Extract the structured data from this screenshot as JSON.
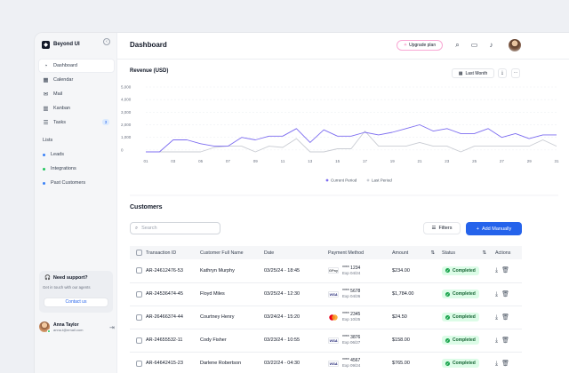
{
  "brand": {
    "name": "Beyond UI"
  },
  "sidebar": {
    "items": [
      {
        "label": "Dashboard",
        "icon": "dashboard-icon",
        "active": true
      },
      {
        "label": "Calendar",
        "icon": "calendar-icon"
      },
      {
        "label": "Mail",
        "icon": "mail-icon"
      },
      {
        "label": "Kanban",
        "icon": "kanban-icon"
      },
      {
        "label": "Tasks",
        "icon": "tasks-icon",
        "badge": "3"
      }
    ],
    "lists_heading": "Lists",
    "lists": [
      {
        "label": "Leads",
        "color": "#3b82f6"
      },
      {
        "label": "Integrations",
        "color": "#22c55e"
      },
      {
        "label": "Past Customers",
        "color": "#3b82f6"
      }
    ],
    "support": {
      "title": "Need support?",
      "subtitle": "Get in touch with our agents",
      "button": "Contact us"
    },
    "user": {
      "name": "Anna Taylor",
      "email": "anna.t@email.com"
    }
  },
  "header": {
    "title": "Dashboard",
    "upgrade": "Upgrade plan"
  },
  "revenue": {
    "title": "Revenue (USD)",
    "period": "Last Month",
    "more": "···",
    "download": "⤓"
  },
  "chart_data": {
    "type": "line",
    "title": "Revenue (USD)",
    "x": [
      "01",
      "02",
      "03",
      "04",
      "05",
      "06",
      "07",
      "08",
      "09",
      "10",
      "11",
      "12",
      "13",
      "14",
      "15",
      "16",
      "17",
      "18",
      "19",
      "20",
      "21",
      "22",
      "23",
      "24",
      "25",
      "26",
      "27",
      "28",
      "29",
      "30",
      "31"
    ],
    "x_tick_labels": [
      "01",
      "03",
      "05",
      "07",
      "09",
      "11",
      "13",
      "15",
      "17",
      "19",
      "21",
      "23",
      "25",
      "27",
      "29",
      "31"
    ],
    "y_tick_labels": [
      "5,000",
      "4,000",
      "3,000",
      "2,000",
      "1,000",
      "0"
    ],
    "ylim": [
      -150,
      5000
    ],
    "series": [
      {
        "name": "Current Period",
        "color": "#7c6cf0",
        "values": [
          -150,
          -150,
          800,
          800,
          500,
          300,
          300,
          1000,
          800,
          1100,
          1100,
          1700,
          600,
          1600,
          1100,
          1100,
          1400,
          1200,
          1400,
          1700,
          2000,
          1500,
          1700,
          1300,
          1300,
          1700,
          1000,
          1300,
          900,
          1200,
          1200
        ]
      },
      {
        "name": "Last Period",
        "color": "#c9ccd3",
        "values": [
          -150,
          -150,
          -150,
          -150,
          -150,
          200,
          300,
          300,
          -150,
          300,
          200,
          900,
          -150,
          -150,
          100,
          100,
          1500,
          300,
          300,
          300,
          600,
          300,
          300,
          -150,
          300,
          300,
          300,
          300,
          300,
          800,
          300
        ]
      }
    ],
    "legend": "bottom",
    "grid": true
  },
  "customers": {
    "title": "Customers",
    "search_placeholder": "Search",
    "filters": "Filters",
    "add": "Add Manually",
    "columns": [
      "Transaction ID",
      "Customer Full Name",
      "Date",
      "Payment Method",
      "Amount",
      "Status",
      "Actions"
    ],
    "rows": [
      {
        "id": "AR-24612476-53",
        "name": "Kathryn Murphy",
        "date": "03/25/24 - 18:45",
        "card": "GPay",
        "number": "**** 1234",
        "exp": "Exp 04/24",
        "amount": "$234.00",
        "status": "Completed"
      },
      {
        "id": "AR-24536474-45",
        "name": "Floyd Miles",
        "date": "03/25/24 - 12:30",
        "card": "VISA",
        "number": "**** 5678",
        "exp": "Exp 04/26",
        "amount": "$1,784.00",
        "status": "Completed"
      },
      {
        "id": "AR-26466374-44",
        "name": "Courtney Henry",
        "date": "03/24/24 - 15:20",
        "card": "MC",
        "number": "**** 2345",
        "exp": "Exp 10/25",
        "amount": "$24.50",
        "status": "Completed"
      },
      {
        "id": "AR-24655532-11",
        "name": "Cody Fisher",
        "date": "03/23/24 - 10:55",
        "card": "VISA",
        "number": "**** 3876",
        "exp": "Exp 06/27",
        "amount": "$158.00",
        "status": "Completed"
      },
      {
        "id": "AR-64642415-23",
        "name": "Darlene Robertson",
        "date": "03/22/24 - 04:30",
        "card": "VISA",
        "number": "**** 4567",
        "exp": "Exp 09/24",
        "amount": "$765.00",
        "status": "Completed"
      }
    ]
  }
}
